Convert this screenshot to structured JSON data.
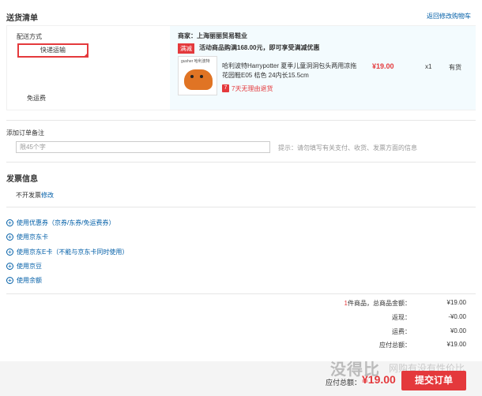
{
  "header": {
    "title": "送货清单",
    "back_link": "返回修改购物车"
  },
  "shipping": {
    "label": "配送方式",
    "method": "快递运输",
    "fee_note": "免运费"
  },
  "merchant": {
    "name": "商家：上海丽丽贸易鞋业"
  },
  "promotion": {
    "tag": "满减",
    "text": "活动商品购满168.00元，即可享受满减优惠"
  },
  "product": {
    "image_brand": "gusher 哈利波特",
    "name": "哈利波特Harrypotter 夏季儿童洞洞包头两用凉拖 花园鞋E05 桔色 24内长15.5cm",
    "return_badge": "7",
    "return_text": "7天无理由退货",
    "price": "¥19.00",
    "qty": "x1",
    "stock": "有货"
  },
  "remark": {
    "label": "添加订单备注",
    "placeholder": "限45个字",
    "tip": "提示：请勿填写有关支付、收货、发票方面的信息"
  },
  "invoice": {
    "title": "发票信息",
    "text": "不开发票",
    "edit": "修改"
  },
  "options": [
    {
      "label": "使用优惠券（京券/东券/免运费券）"
    },
    {
      "label": "使用京东卡"
    },
    {
      "label": "使用京东E卡（不能与京东卡同时使用）"
    },
    {
      "label": "使用京豆"
    },
    {
      "label": "使用余额"
    }
  ],
  "summary": {
    "count": "1",
    "count_suffix": "件商品，总商品金额：",
    "total_goods": "¥19.00",
    "discount_label": "返现：",
    "discount": "-¥0.00",
    "freight_label": "运费：",
    "freight": "¥0.00",
    "payable_label": "应付总额：",
    "payable": "¥19.00"
  },
  "footer": {
    "pay_label": "应付总额：",
    "pay_amount": "¥19.00",
    "submit": "提交订单",
    "watermark": "没得比",
    "watermark_sub": "网购有没有性价比"
  },
  "colors": {
    "accent": "#e4393c",
    "link": "#005ea7",
    "panel_bg": "#f3fbfe"
  }
}
